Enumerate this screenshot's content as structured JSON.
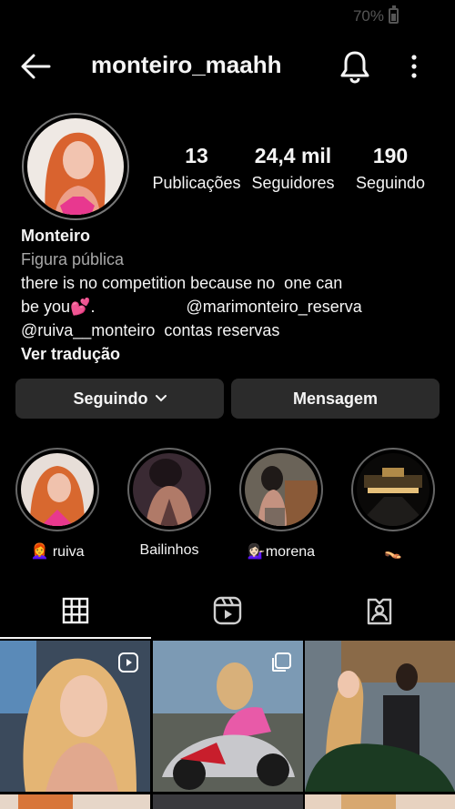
{
  "status_bar": {
    "battery": "70%"
  },
  "header": {
    "username": "monteiro_maahh"
  },
  "profile": {
    "stats": [
      {
        "value": "13",
        "label": "Publicações"
      },
      {
        "value": "24,4 mil",
        "label": "Seguidores"
      },
      {
        "value": "190",
        "label": "Seguindo"
      }
    ],
    "name": "Monteiro",
    "category": "Figura pública",
    "bio_lines": [
      "there is no competition because no  one can",
      "be you💕.                    @marimonteiro_reserva",
      "@ruiva__monteiro  contas reservas"
    ],
    "translate_label": "Ver tradução"
  },
  "actions": {
    "following_label": "Seguindo",
    "message_label": "Mensagem"
  },
  "highlights": [
    {
      "label": "👩‍🦰 ruiva"
    },
    {
      "label": "Bailinhos"
    },
    {
      "label": "💁🏻‍♀️morena"
    },
    {
      "label": "👡"
    }
  ],
  "tabs": [
    "grid-icon",
    "reels-icon",
    "tagged-icon"
  ],
  "posts": [
    {
      "type": "reel"
    },
    {
      "type": "carousel"
    },
    {
      "type": "photo"
    }
  ]
}
